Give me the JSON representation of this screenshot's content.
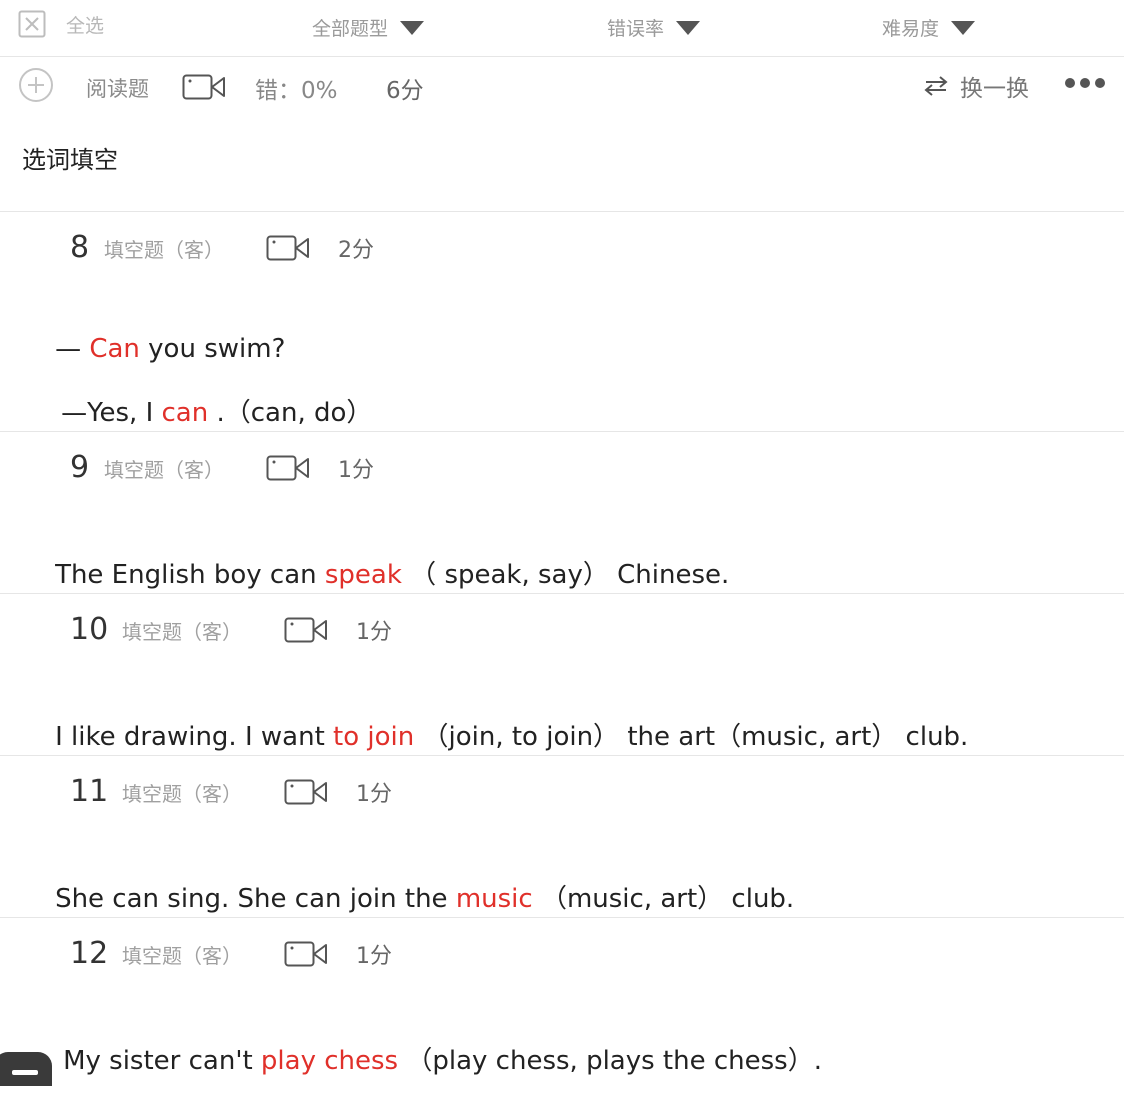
{
  "filter_bar": {
    "select_all_label": "全选",
    "type_filter": "全部题型",
    "error_filter": "错误率",
    "difficulty_filter": "难易度"
  },
  "section_header": {
    "type_label": "阅读题",
    "error_rate": "错：0%",
    "score": "6分",
    "swap_label": "换一换"
  },
  "section_title": "选词填空",
  "questions": [
    {
      "number": "8",
      "type": "填空题（客）",
      "score": "2分",
      "lines": [
        [
          {
            "t": "— ",
            "answer": false
          },
          {
            "t": "Can",
            "answer": true
          },
          {
            "t": " you swim?",
            "answer": false
          }
        ],
        [
          {
            "t": "—Yes, I ",
            "answer": false
          },
          {
            "t": "can",
            "answer": true
          },
          {
            "t": " .（can, do）",
            "answer": false
          }
        ]
      ]
    },
    {
      "number": "9",
      "type": "填空题（客）",
      "score": "1分",
      "lines": [
        [
          {
            "t": "The English boy can ",
            "answer": false
          },
          {
            "t": "speak",
            "answer": true
          },
          {
            "t": " （ speak, say） Chinese.",
            "answer": false
          }
        ]
      ]
    },
    {
      "number": "10",
      "type": "填空题（客）",
      "score": "1分",
      "lines": [
        [
          {
            "t": "I like drawing. I want ",
            "answer": false
          },
          {
            "t": "to join",
            "answer": true
          },
          {
            "t": " （join, to join） the art（music, art） club.",
            "answer": false
          }
        ]
      ]
    },
    {
      "number": "11",
      "type": "填空题（客）",
      "score": "1分",
      "lines": [
        [
          {
            "t": "She can sing. She can join the ",
            "answer": false
          },
          {
            "t": "music",
            "answer": true
          },
          {
            "t": " （music, art） club.",
            "answer": false
          }
        ]
      ]
    },
    {
      "number": "12",
      "type": "填空题（客）",
      "score": "1分",
      "lines": [
        [
          {
            "t": "My sister can't ",
            "answer": false
          },
          {
            "t": "play chess",
            "answer": true
          },
          {
            "t": " （play chess, plays the chess）.",
            "answer": false
          }
        ]
      ]
    }
  ],
  "colors": {
    "answer": "#e0302a",
    "divider": "#e6e6e6",
    "muted": "#9a9a9a"
  }
}
